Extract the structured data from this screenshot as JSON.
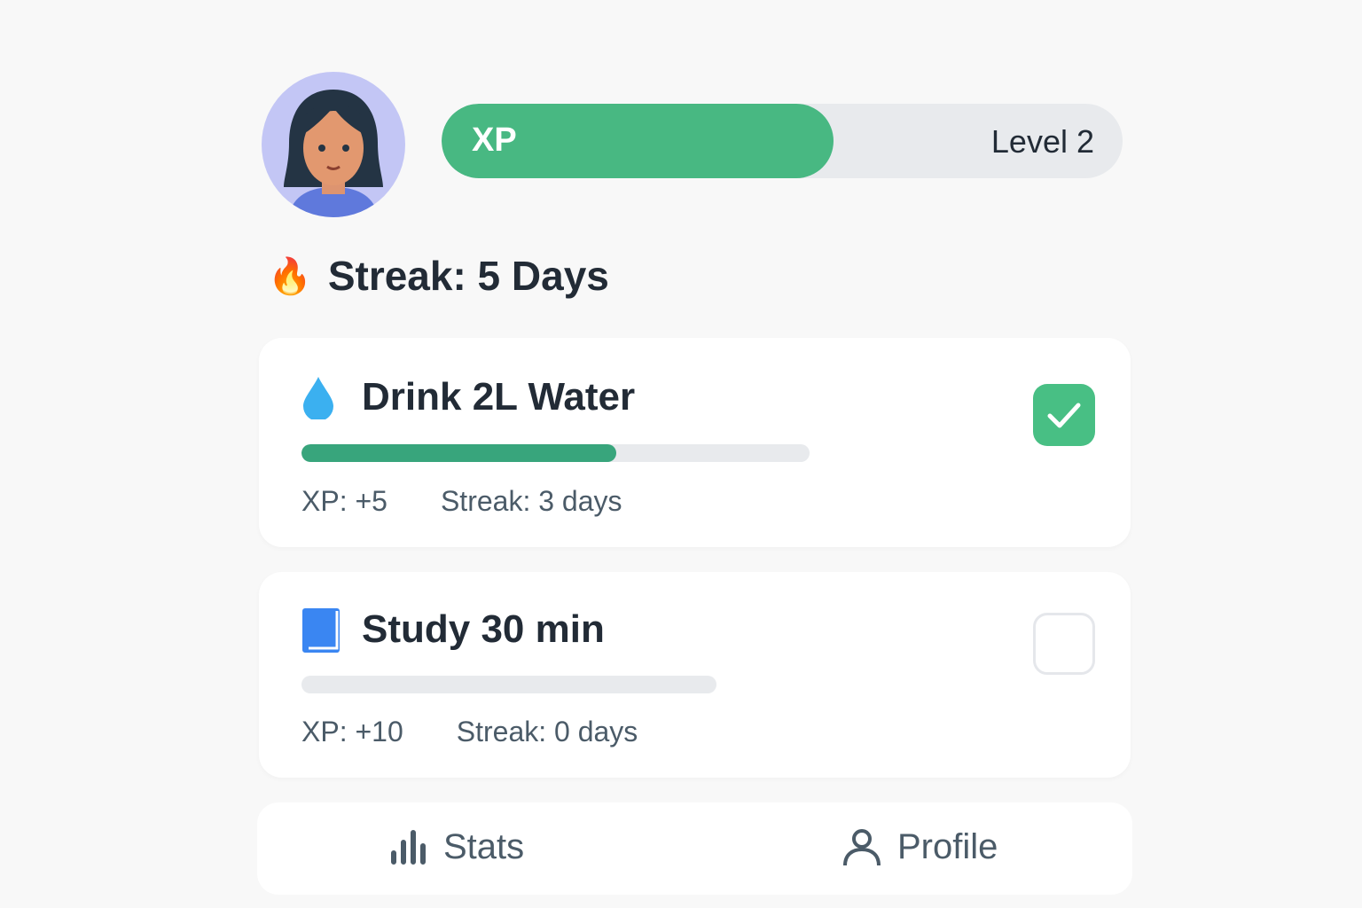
{
  "header": {
    "xp_label": "XP",
    "xp_progress_percent": 57.5,
    "level": "Level 2"
  },
  "streak": {
    "icon": "fire-icon",
    "text": "Streak: 5 Days"
  },
  "habits": [
    {
      "icon": "water-drop-icon",
      "title": "Drink 2L Water",
      "progress_percent": 62,
      "xp": "XP: +5",
      "streak": "Streak: 3 days",
      "completed": true
    },
    {
      "icon": "book-icon",
      "title": "Study 30 min",
      "progress_percent": 0,
      "xp": "XP: +10",
      "streak": "Streak: 0 days",
      "completed": false
    }
  ],
  "nav": {
    "stats": "Stats",
    "profile": "Profile"
  },
  "colors": {
    "green": "#48b882",
    "progress": "#38a57c",
    "track": "#e8eaed"
  }
}
